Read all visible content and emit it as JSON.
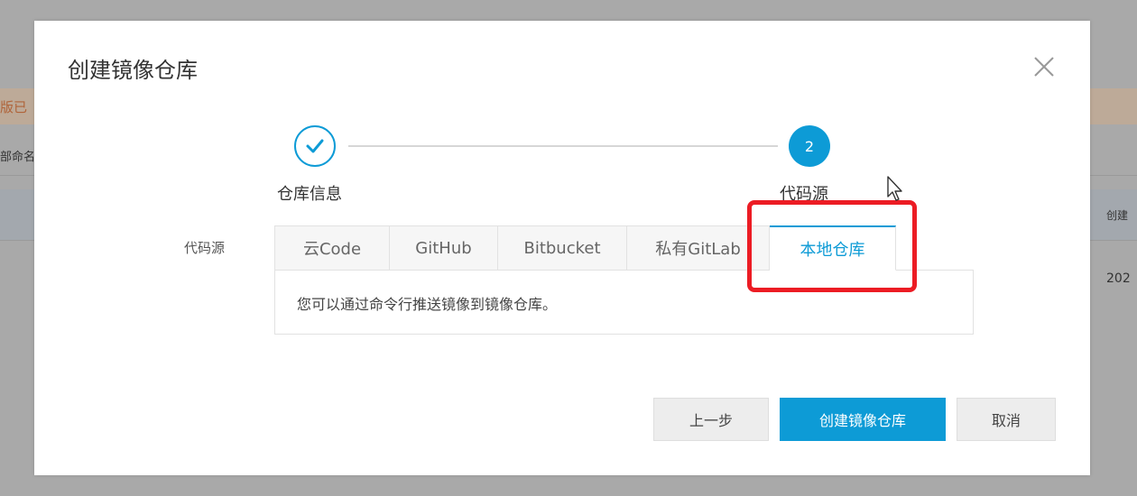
{
  "background": {
    "notice_fragment": "版已",
    "row_fragment": "部命名",
    "header_fragment": "创建",
    "value_fragment": "202"
  },
  "dialog": {
    "title": "创建镜像仓库",
    "close_icon": "close-icon"
  },
  "steps": [
    {
      "number": "1",
      "label": "仓库信息",
      "state": "done",
      "icon": "check-icon"
    },
    {
      "number": "2",
      "label": "代码源",
      "state": "active"
    }
  ],
  "code_source": {
    "label": "代码源",
    "tabs": [
      {
        "label": "云Code",
        "active": false
      },
      {
        "label": "GitHub",
        "active": false
      },
      {
        "label": "Bitbucket",
        "active": false
      },
      {
        "label": "私有GitLab",
        "active": false
      },
      {
        "label": "本地仓库",
        "active": true
      }
    ],
    "panel_text": "您可以通过命令行推送镜像到镜像仓库。"
  },
  "buttons": {
    "prev": "上一步",
    "create": "创建镜像仓库",
    "cancel": "取消"
  },
  "colors": {
    "accent": "#0d9bd6",
    "highlight": "#ec1c24",
    "overlay": "#a9a9a9"
  }
}
